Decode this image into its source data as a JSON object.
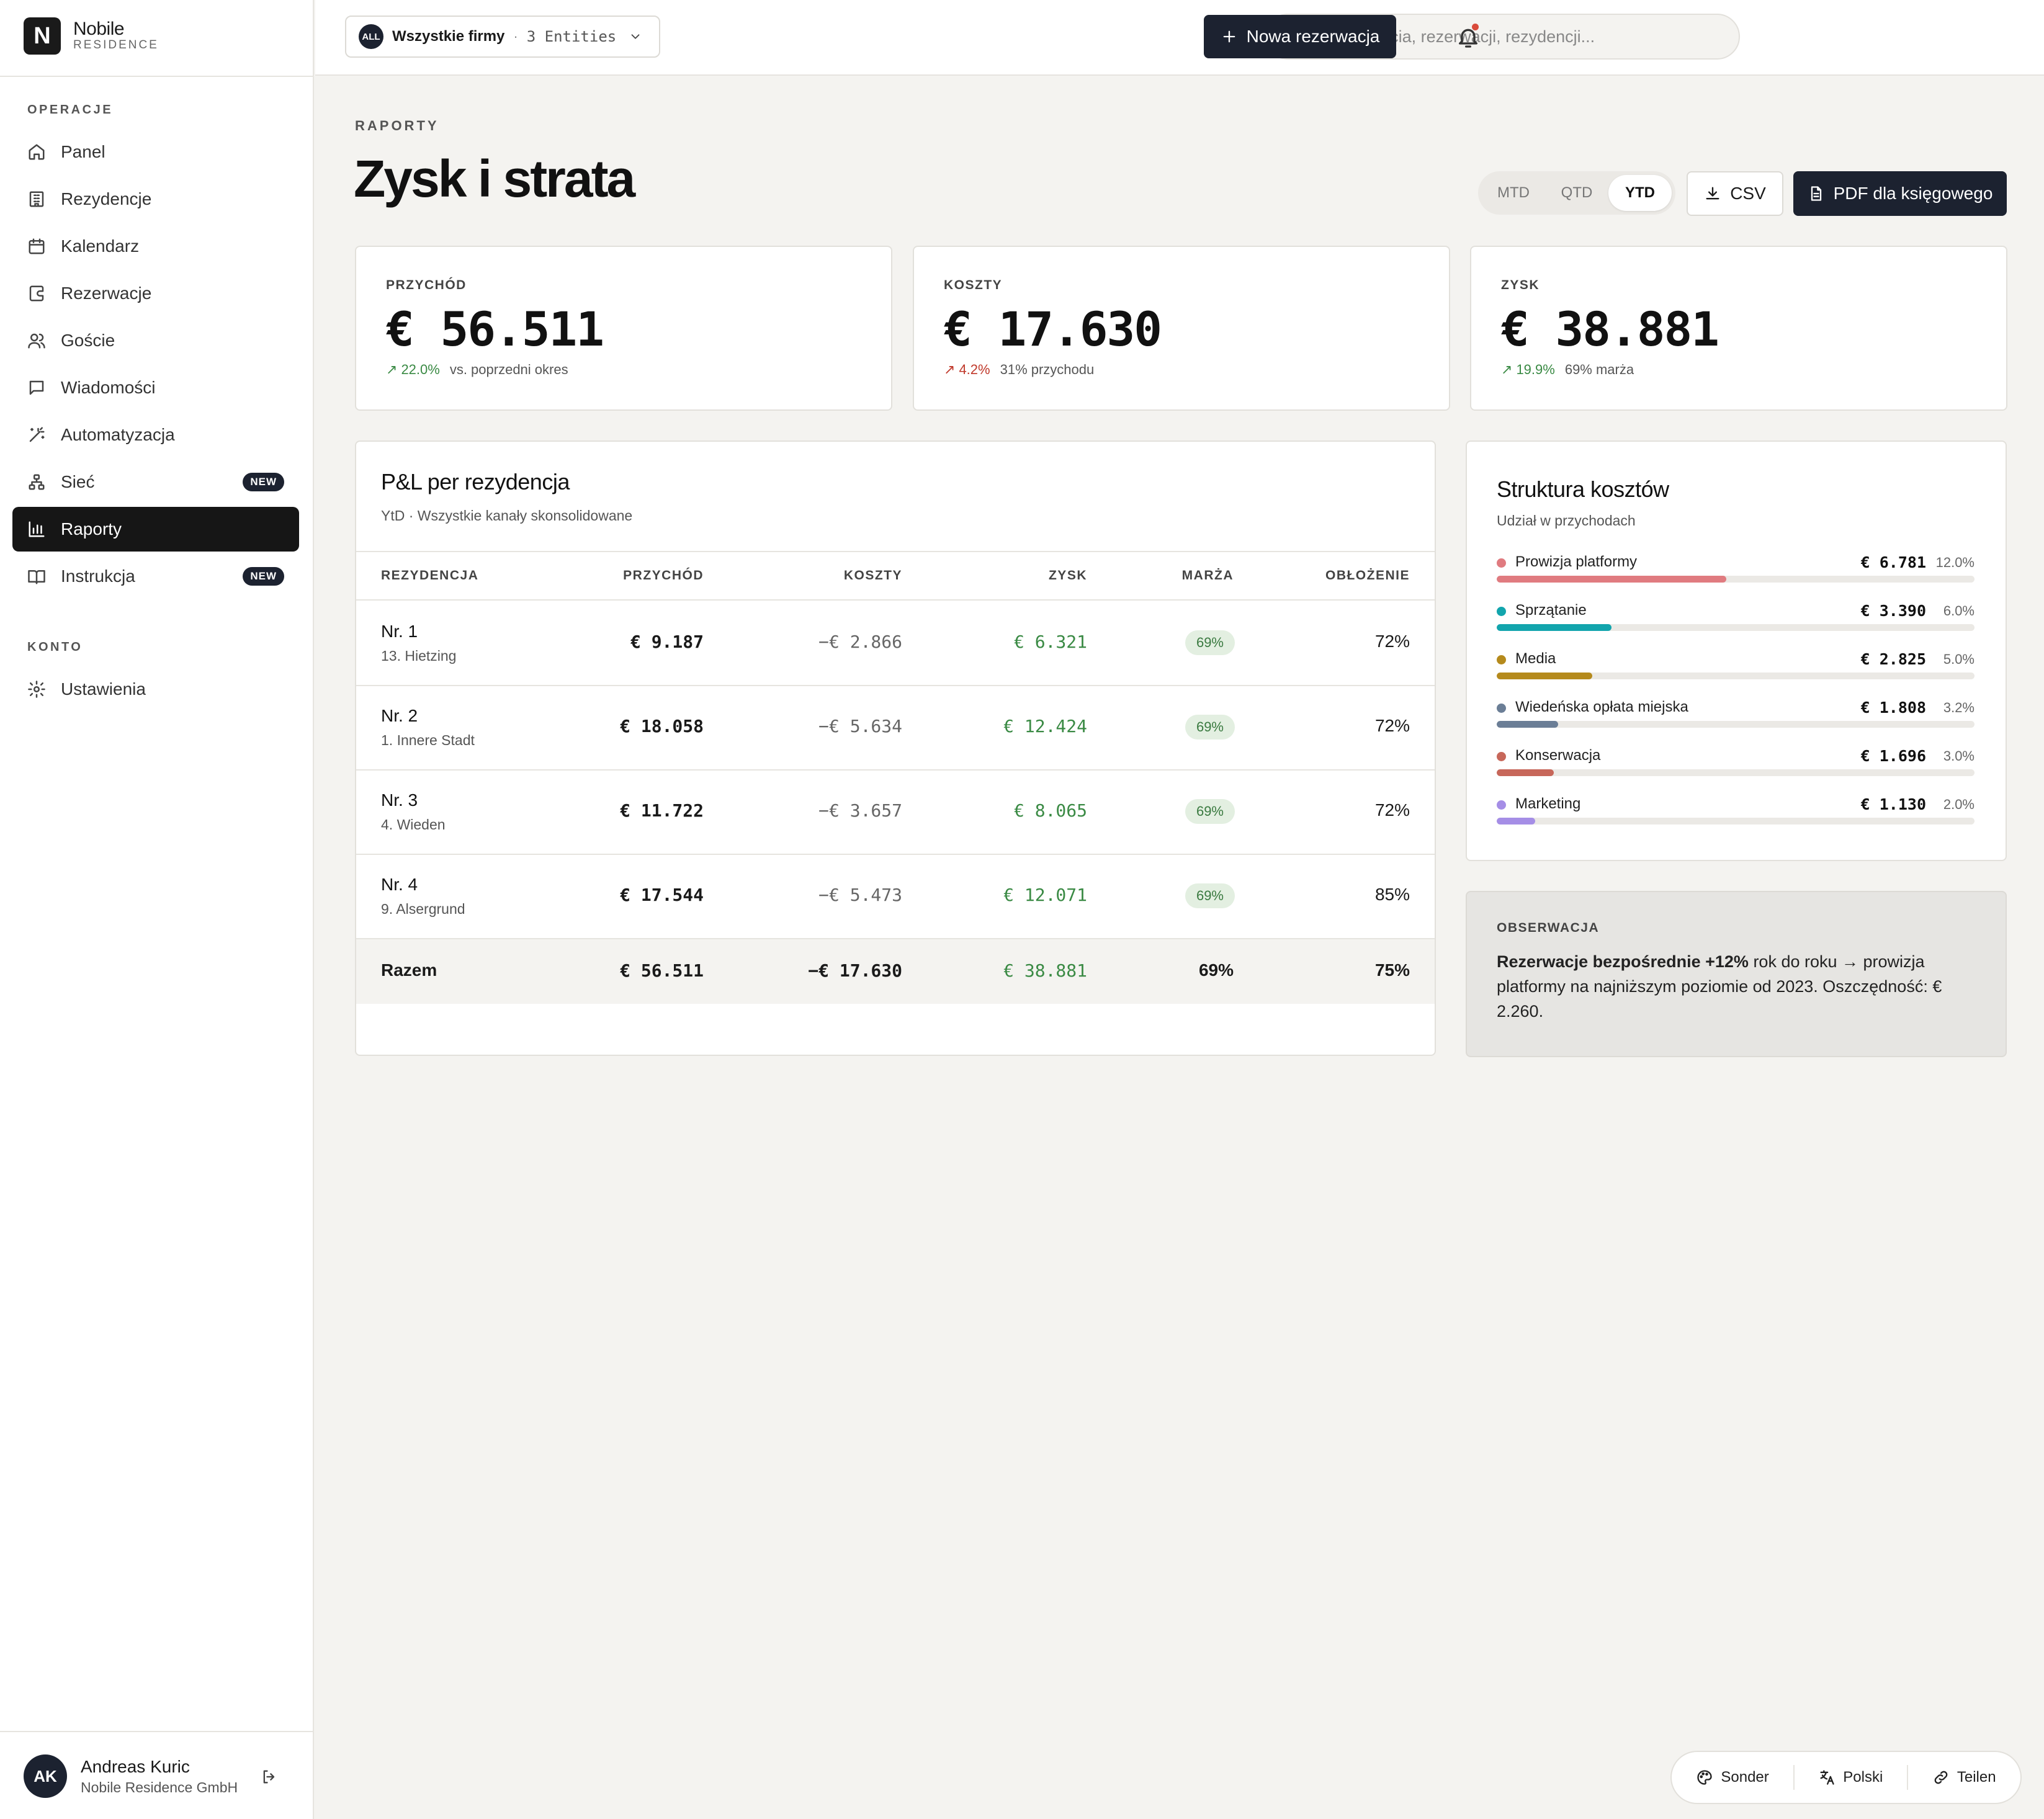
{
  "brand": {
    "logo_letter": "N",
    "name": "Nobile",
    "sub": "RESIDENCE"
  },
  "sidebar": {
    "section_ops": "OPERACJE",
    "items": [
      {
        "label": "Panel",
        "icon": "home-icon"
      },
      {
        "label": "Rezydencje",
        "icon": "building-icon"
      },
      {
        "label": "Kalendarz",
        "icon": "calendar-icon"
      },
      {
        "label": "Rezerwacje",
        "icon": "booking-icon"
      },
      {
        "label": "Goście",
        "icon": "users-icon"
      },
      {
        "label": "Wiadomości",
        "icon": "message-icon"
      },
      {
        "label": "Automatyzacja",
        "icon": "wand-icon"
      },
      {
        "label": "Sieć",
        "icon": "network-icon",
        "badge": "NEW"
      },
      {
        "label": "Raporty",
        "icon": "chart-icon",
        "active": true
      },
      {
        "label": "Instrukcja",
        "icon": "book-icon",
        "badge": "NEW"
      }
    ],
    "section_account": "KONTO",
    "settings_label": "Ustawienia"
  },
  "user": {
    "initials": "AK",
    "name": "Andreas Kuric",
    "org": "Nobile Residence GmbH"
  },
  "topbar": {
    "entity_badge": "ALL",
    "entity_name": "Wszystkie firmy",
    "entity_sep": "·",
    "entity_count": "3 Entities",
    "search_placeholder": "Szukaj gościa, rezerwacji, rezydencji...",
    "new_reservation": "Nowa rezerwacja"
  },
  "page": {
    "kicker": "RAPORTY",
    "title": "Zysk i strata",
    "periods": [
      "MTD",
      "QTD",
      "YTD"
    ],
    "active_period": "YTD",
    "csv_label": "CSV",
    "pdf_label": "PDF dla księgowego"
  },
  "kpis": [
    {
      "label": "PRZYCHÓD",
      "value": "€ 56.511",
      "delta": "22.0%",
      "direction": "up",
      "note": "vs. poprzedni okres"
    },
    {
      "label": "KOSZTY",
      "value": "€ 17.630",
      "delta": "4.2%",
      "direction": "up-bad",
      "note": "31% przychodu"
    },
    {
      "label": "ZYSK",
      "value": "€ 38.881",
      "delta": "19.9%",
      "direction": "up",
      "note": "69% marża"
    }
  ],
  "pl": {
    "title": "P&L per rezydencja",
    "subtitle": "YtD · Wszystkie kanały skonsolidowane",
    "columns": [
      "REZYDENCJA",
      "PRZYCHÓD",
      "KOSZTY",
      "ZYSK",
      "MARŻA",
      "OBŁOŻENIE"
    ],
    "rows": [
      {
        "name": "Nr. 1",
        "location": "13. Hietzing",
        "revenue": "€ 9.187",
        "costs": "−€ 2.866",
        "profit": "€ 6.321",
        "margin": "69%",
        "occupancy": "72%"
      },
      {
        "name": "Nr. 2",
        "location": "1. Innere Stadt",
        "revenue": "€ 18.058",
        "costs": "−€ 5.634",
        "profit": "€ 12.424",
        "margin": "69%",
        "occupancy": "72%"
      },
      {
        "name": "Nr. 3",
        "location": "4. Wieden",
        "revenue": "€ 11.722",
        "costs": "−€ 3.657",
        "profit": "€ 8.065",
        "margin": "69%",
        "occupancy": "72%"
      },
      {
        "name": "Nr. 4",
        "location": "9. Alsergrund",
        "revenue": "€ 17.544",
        "costs": "−€ 5.473",
        "profit": "€ 12.071",
        "margin": "69%",
        "occupancy": "85%"
      }
    ],
    "total": {
      "name": "Razem",
      "revenue": "€ 56.511",
      "costs": "−€ 17.630",
      "profit": "€ 38.881",
      "margin": "69%",
      "occupancy": "75%"
    }
  },
  "costs": {
    "title": "Struktura kosztów",
    "subtitle": "Udział w przychodach",
    "items": [
      {
        "name": "Prowizja platformy",
        "value": "€ 6.781",
        "pct": "12.0%",
        "share": 0.12,
        "color": "#e07b80"
      },
      {
        "name": "Sprzątanie",
        "value": "€ 3.390",
        "pct": "6.0%",
        "share": 0.06,
        "color": "#12a5ad"
      },
      {
        "name": "Media",
        "value": "€ 2.825",
        "pct": "5.0%",
        "share": 0.05,
        "color": "#b58a1c"
      },
      {
        "name": "Wiedeńska opłata miejska",
        "value": "€ 1.808",
        "pct": "3.2%",
        "share": 0.032,
        "color": "#6b7e96"
      },
      {
        "name": "Konserwacja",
        "value": "€ 1.696",
        "pct": "3.0%",
        "share": 0.03,
        "color": "#c7675a"
      },
      {
        "name": "Marketing",
        "value": "€ 1.130",
        "pct": "2.0%",
        "share": 0.02,
        "color": "#a58ee6"
      }
    ]
  },
  "observation": {
    "label": "OBSERWACJA",
    "bold": "Rezerwacje bezpośrednie +12%",
    "text": " rok do roku → prowizja platformy na najniższym poziomie od 2023. Oszczędność: € 2.260."
  },
  "footer": {
    "theme": "Sonder",
    "language": "Polski",
    "share": "Teilen"
  }
}
